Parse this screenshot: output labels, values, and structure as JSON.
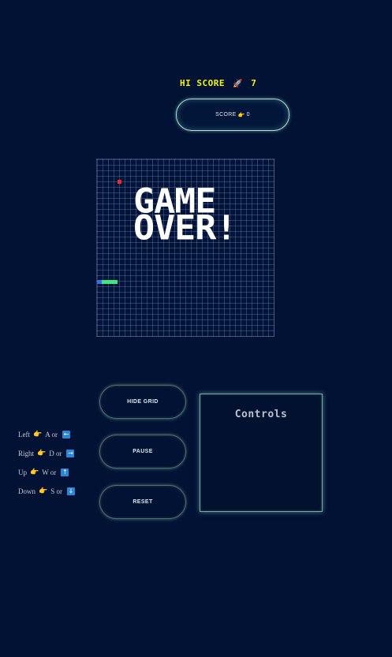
{
  "hud": {
    "hi_score_label": "HI SCORE",
    "hi_score_icon": "🚀",
    "hi_score_value": "7",
    "score_label": "SCORE",
    "score_icon": "👉",
    "score_value": "0"
  },
  "board": {
    "overlay_text": "GAME OVER!"
  },
  "buttons": {
    "hide_grid": "HIDE GRID",
    "pause": "PAUSE",
    "reset": "RESET"
  },
  "controls": {
    "title": "Controls",
    "pointer_icon": "👉",
    "rows": [
      {
        "direction": "Left",
        "key": "A or",
        "arrow": "←"
      },
      {
        "direction": "Right",
        "key": "D or",
        "arrow": "→"
      },
      {
        "direction": "Up",
        "key": "W or",
        "arrow": "↑"
      },
      {
        "direction": "Down",
        "key": "S or",
        "arrow": "↓"
      }
    ]
  },
  "colors": {
    "background": "#011235",
    "hi_score": "#f5f500",
    "food": "#ee2a2a",
    "snake_head": "#3a6ee8",
    "snake_body": "#3ee67f",
    "accent_glow": "#b9dcd2"
  }
}
